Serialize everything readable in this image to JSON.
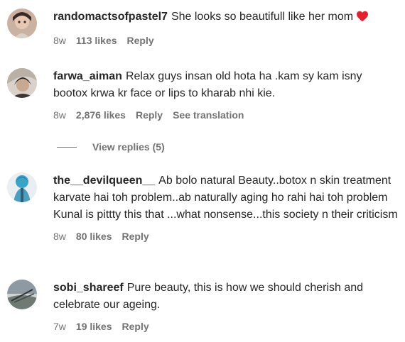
{
  "comments": [
    {
      "username": "randomactsofpastel7",
      "text": "She looks so beautifull like her mom",
      "age": "8w",
      "likes": "113 likes",
      "reply": "Reply",
      "has_heart": true,
      "heart_color": "#e8202d"
    },
    {
      "username": "farwa_aiman",
      "text": "Relax guys insan old hota ha .kam sy kam isny bootox krwa kr face or lips to kharab nhi kie.",
      "age": "8w",
      "likes": "2,876 likes",
      "reply": "Reply",
      "see_translation": "See translation"
    },
    {
      "username": "the__devilqueen__",
      "text": "Ab bolo natural Beauty..botox n skin treatment karvate hai toh problem..ab naturally aging ho rahi hai toh problem Kunal is pittty this that ...what nonsense...this society n their criticism",
      "age": "8w",
      "likes": "80 likes",
      "reply": "Reply"
    },
    {
      "username": "sobi_shareef",
      "text": "Pure beauty, this is how we should cherish and celebrate our ageing.",
      "age": "7w",
      "likes": "19 likes",
      "reply": "Reply"
    }
  ],
  "view_replies": "View replies (5)",
  "colors": {
    "text": "#262626",
    "secondary": "#737373",
    "heart": "#e8202d"
  },
  "icons": {
    "heart": "heart-icon"
  }
}
